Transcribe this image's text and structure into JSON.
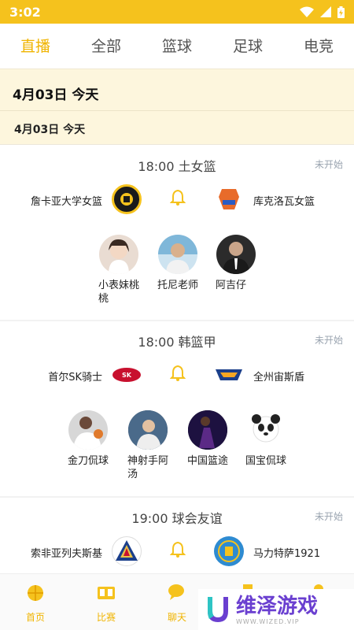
{
  "status_bar": {
    "time": "3:02"
  },
  "tabs": [
    {
      "label": "直播",
      "active": true
    },
    {
      "label": "全部"
    },
    {
      "label": "篮球"
    },
    {
      "label": "足球"
    },
    {
      "label": "电竞"
    }
  ],
  "date_header": {
    "big": "4月03日  今天",
    "small": "4月03日    今天"
  },
  "matches": [
    {
      "time_league": "18:00  土女篮",
      "status": "未开始",
      "home": "詹卡亚大学女篮",
      "away": "库克洛瓦女篮",
      "anchors": [
        "小表妹桃桃",
        "托尼老师",
        "阿吉仔"
      ]
    },
    {
      "time_league": "18:00  韩篮甲",
      "status": "未开始",
      "home": "首尔SK骑士",
      "away": "全州宙斯盾",
      "anchors": [
        "金刀侃球",
        "神射手阿汤",
        "中国篮途",
        "国宝侃球"
      ]
    },
    {
      "time_league": "19:00  球会友谊",
      "status": "未开始",
      "home": "索非亚列夫斯基",
      "away": "马力特萨1921",
      "anchors": []
    }
  ],
  "bottom_nav": [
    {
      "label": "首页",
      "icon": "basketball-home-icon"
    },
    {
      "label": "比赛",
      "icon": "scoreboard-icon",
      "active": true
    },
    {
      "label": "聊天",
      "icon": "chat-bubble-icon"
    },
    {
      "label": "",
      "icon": "trophy-icon"
    },
    {
      "label": "",
      "icon": "profile-icon"
    }
  ],
  "watermark": {
    "text": "维泽游戏",
    "sub": "WWW.WIZED.VIP"
  },
  "colors": {
    "accent": "#f5c21d",
    "active_text": "#f0b400",
    "status": "#9aa4b0"
  }
}
